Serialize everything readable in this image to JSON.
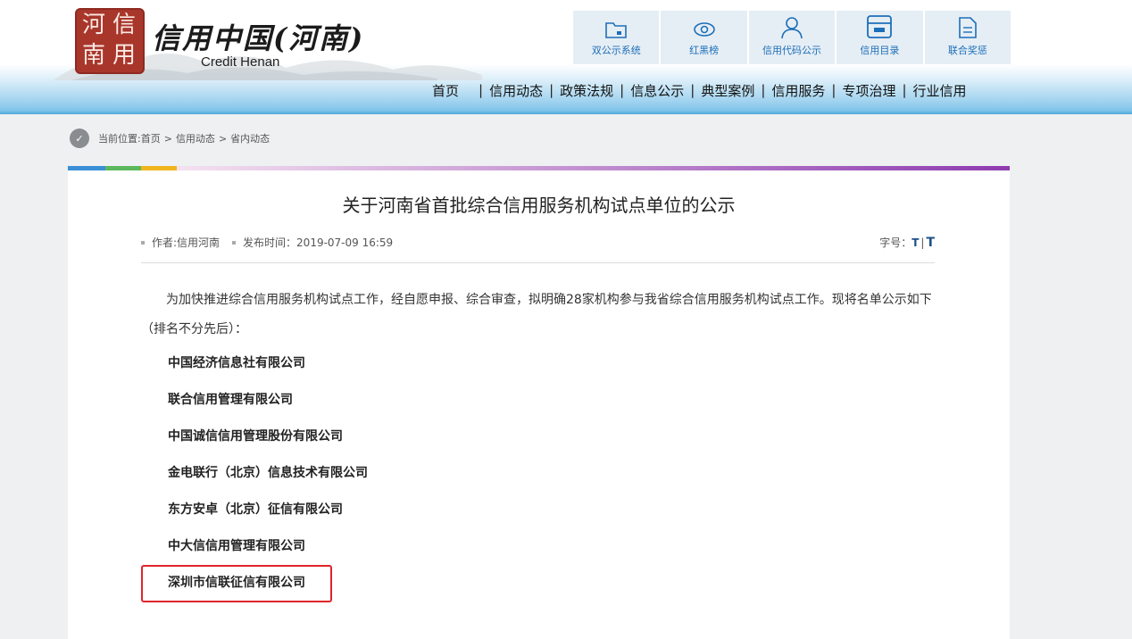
{
  "header": {
    "logo_cn": "信用中国(河南)",
    "logo_en": "Credit Henan",
    "seal_chars": [
      "河",
      "信",
      "南",
      "用"
    ],
    "quick_links": [
      {
        "label": "双公示系统",
        "icon": "folder-icon"
      },
      {
        "label": "红黑榜",
        "icon": "eye-icon"
      },
      {
        "label": "信用代码公示",
        "icon": "user-icon"
      },
      {
        "label": "信用目录",
        "icon": "printer-icon"
      },
      {
        "label": "联合奖惩",
        "icon": "document-icon"
      }
    ],
    "nav": [
      "首页",
      "信用动态",
      "政策法规",
      "信息公示",
      "典型案例",
      "信用服务",
      "专项治理",
      "行业信用"
    ]
  },
  "breadcrumb": {
    "prefix": "当前位置:",
    "items": [
      "首页",
      "信用动态",
      "省内动态"
    ],
    "separator": ">"
  },
  "article": {
    "title": "关于河南省首批综合信用服务机构试点单位的公示",
    "author": "作者:信用河南",
    "publish_time": "发布时间：2019-07-09 16:59",
    "font_size_label": "字号：",
    "font_size_small": "T",
    "font_size_divider": "|",
    "font_size_large": "T",
    "intro": "为加快推进综合信用服务机构试点工作，经自愿申报、综合审查，拟明确28家机构参与我省综合信用服务机构试点工作。现将名单公示如下（排名不分先后）：",
    "companies": [
      "中国经济信息社有限公司",
      "联合信用管理有限公司",
      "中国诚信信用管理股份有限公司",
      "金电联行（北京）信息技术有限公司",
      "东方安卓（北京）征信有限公司",
      "中大信信用管理有限公司",
      "深圳市信联征信有限公司"
    ],
    "highlighted_company_index": 6
  },
  "colors": {
    "accent_blue": "#1d6fb8",
    "highlight_red": "#e0242b",
    "seal_red": "#a8362b",
    "bar_segments": [
      "#3a8fd6",
      "#5cb85c",
      "#f0b51e",
      "#e8a9d8",
      "#8e3bb0"
    ]
  }
}
